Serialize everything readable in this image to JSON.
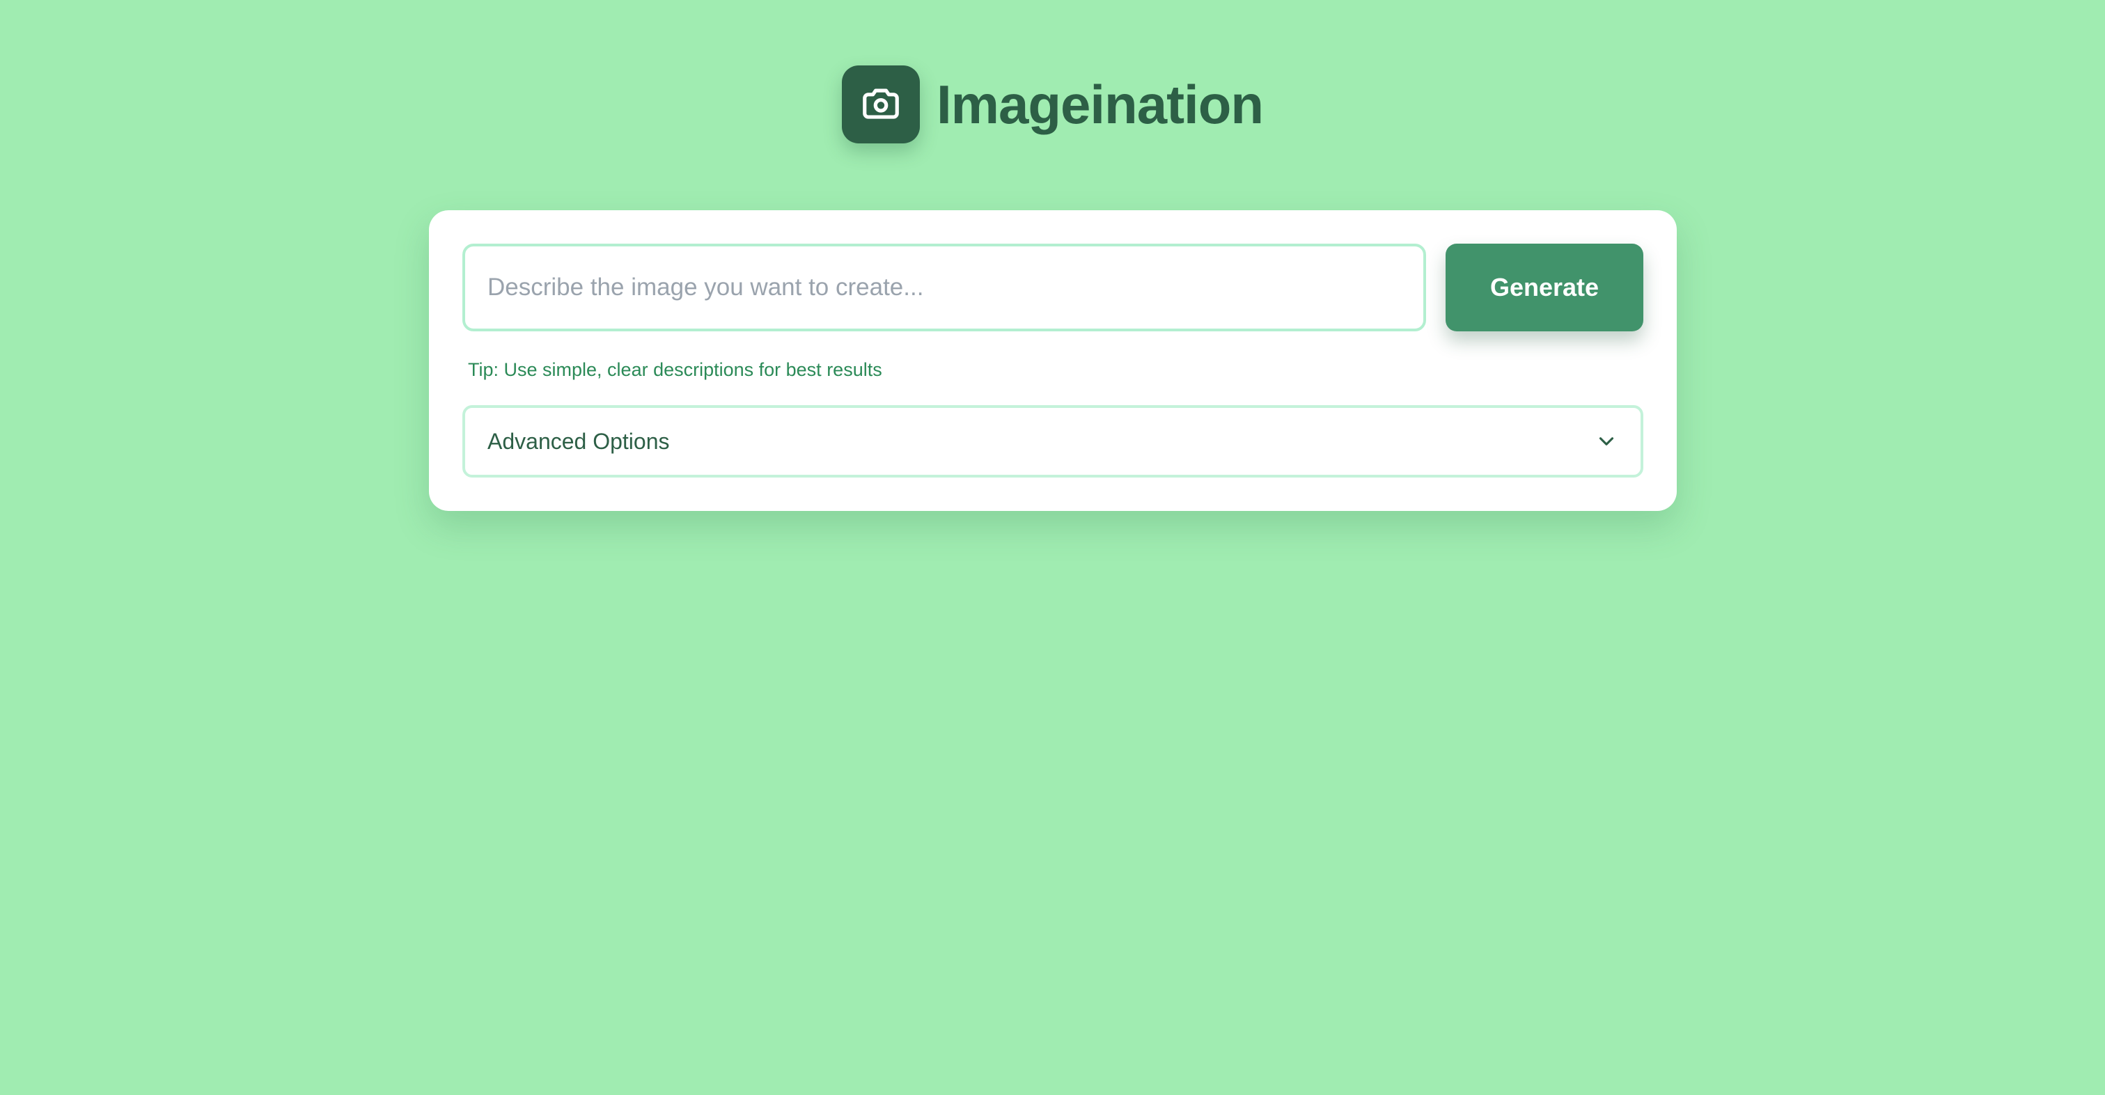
{
  "app": {
    "title": "Imageination",
    "logo_icon": "camera-icon"
  },
  "colors": {
    "background": "#a0ecb1",
    "brand_dark": "#2d5f46",
    "button": "#41936b",
    "tip_text": "#2b8a57",
    "input_border": "#b3efd0"
  },
  "prompt": {
    "value": "",
    "placeholder": "Describe the image you want to create..."
  },
  "generate": {
    "label": "Generate"
  },
  "tip": {
    "text": "Tip: Use simple, clear descriptions for best results"
  },
  "advanced": {
    "label": "Advanced Options",
    "icon": "chevron-down-icon"
  }
}
